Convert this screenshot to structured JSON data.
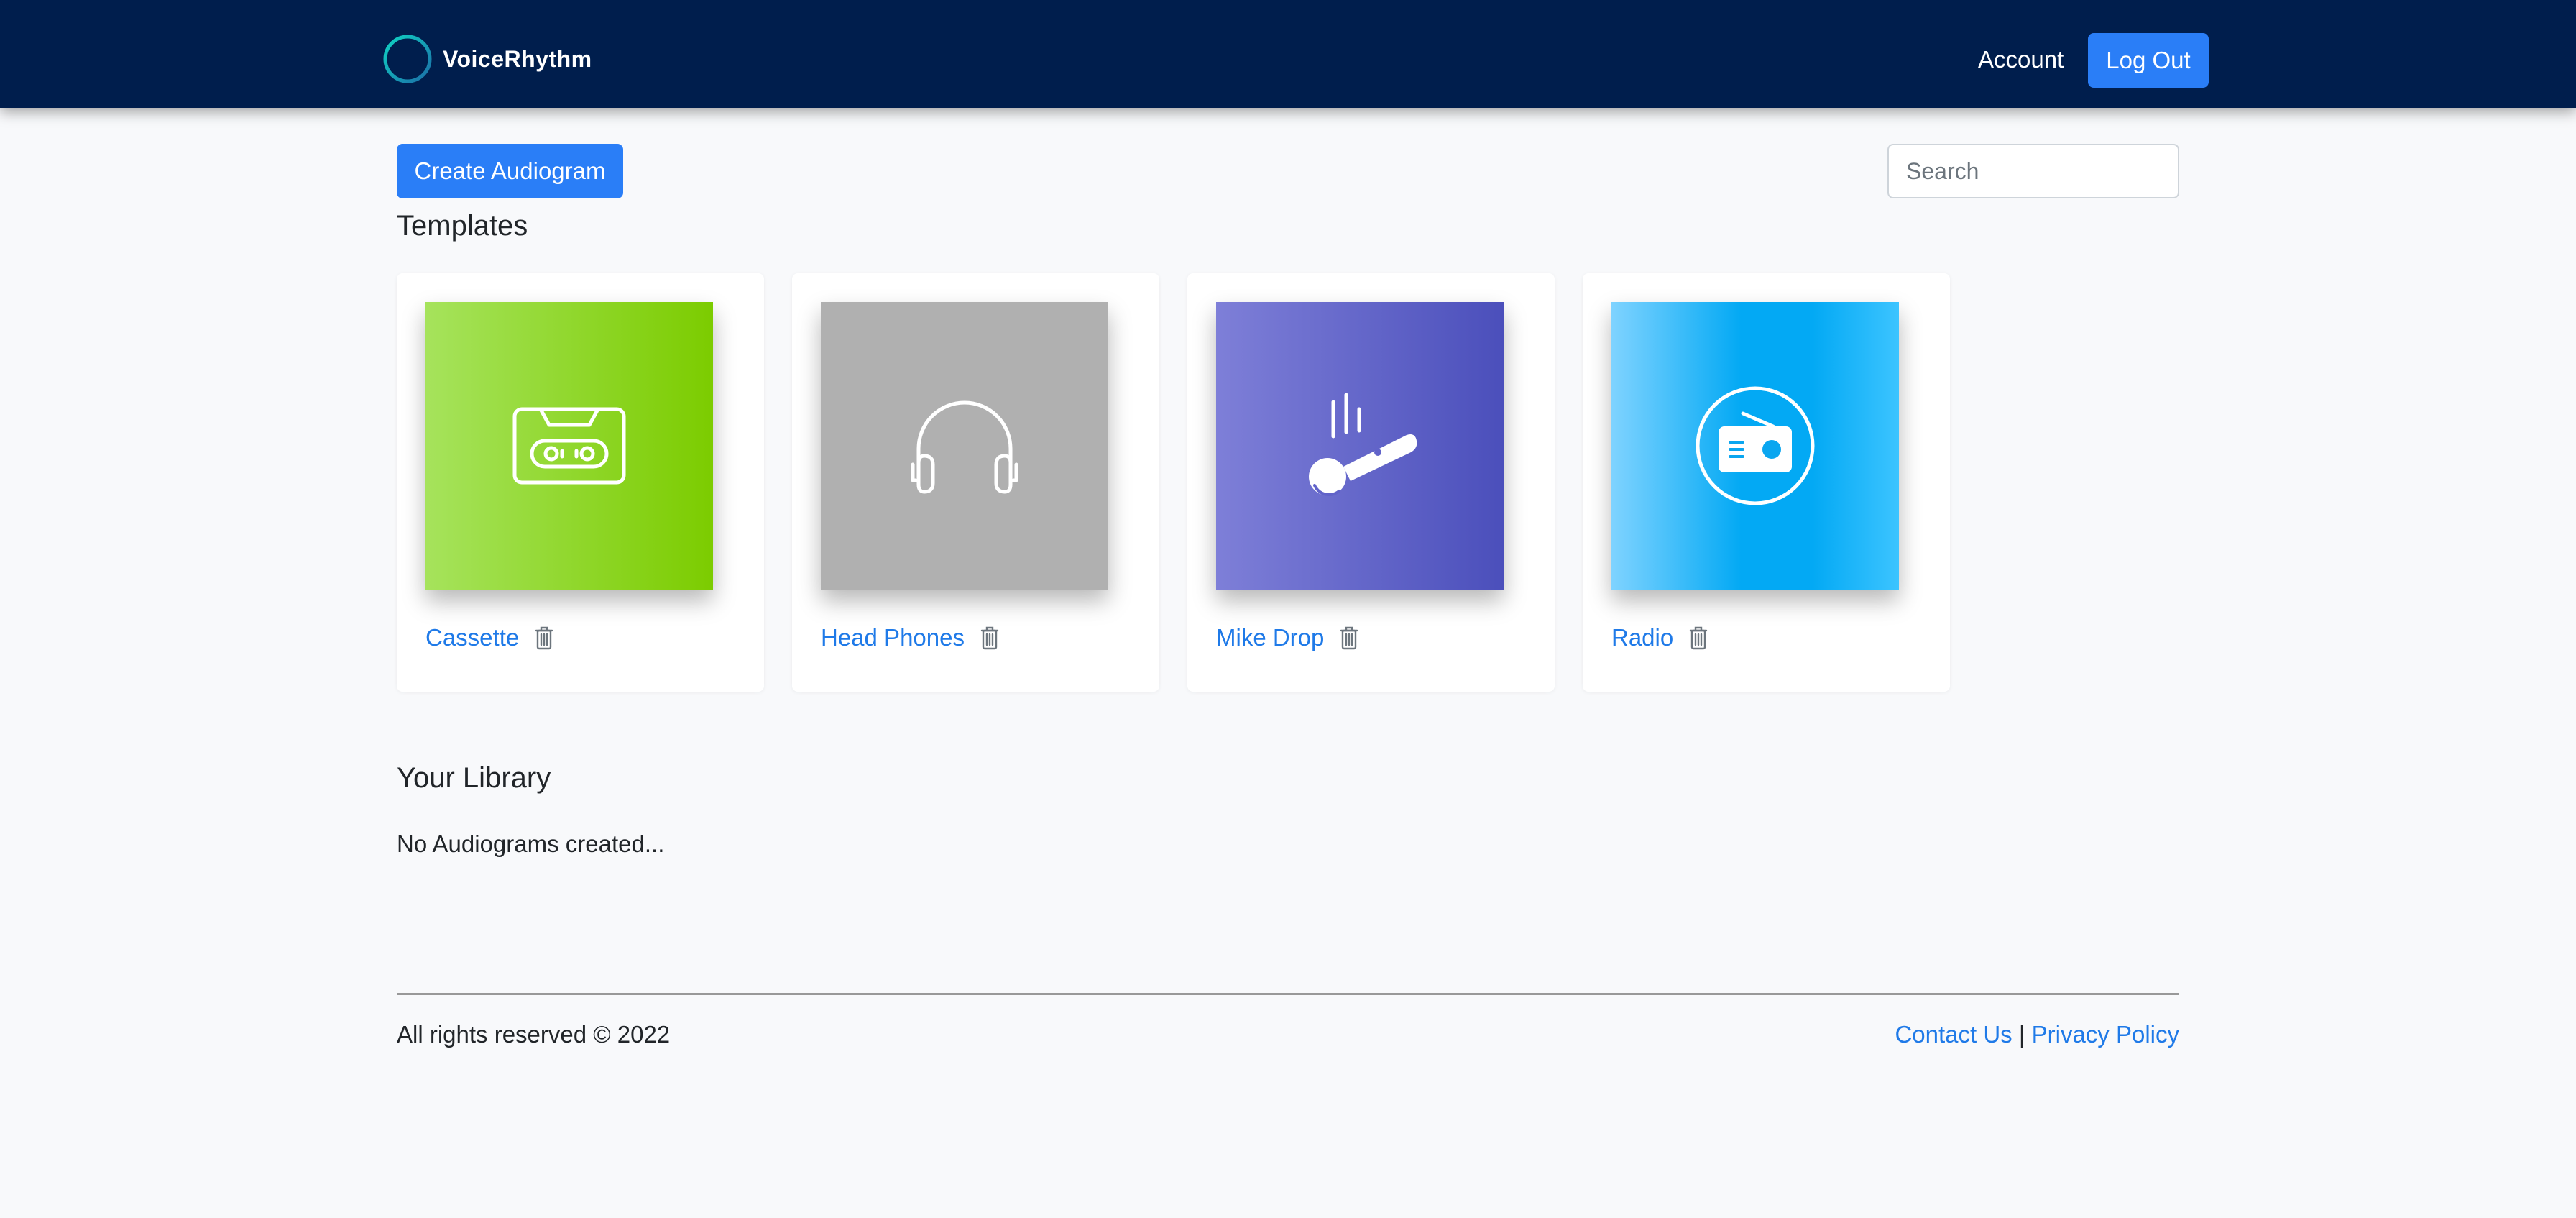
{
  "navbar": {
    "brand_name": "VoiceRhythm",
    "account_label": "Account",
    "logout_label": "Log Out"
  },
  "toolbar": {
    "create_label": "Create Audiogram",
    "search_placeholder": "Search"
  },
  "templates": {
    "title": "Templates",
    "items": [
      {
        "name": "Cassette",
        "icon": "cassette-icon",
        "gradient": [
          "#a6e35c",
          "#7ccc00"
        ]
      },
      {
        "name": "Head Phones",
        "icon": "headphones-icon",
        "gradient": [
          "#b0b0b0",
          "#b0b0b0"
        ]
      },
      {
        "name": "Mike Drop",
        "icon": "microphone-icon",
        "gradient": [
          "#7e7fd8",
          "#4b4fbb"
        ]
      },
      {
        "name": "Radio",
        "icon": "radio-icon",
        "gradient": [
          "#7fd3ff",
          "#03a9f4"
        ]
      }
    ]
  },
  "library": {
    "title": "Your Library",
    "empty_message": "No Audiograms created..."
  },
  "footer": {
    "copyright": "All rights reserved © 2022",
    "contact_label": "Contact Us",
    "separator": "|",
    "privacy_label": "Privacy Policy"
  },
  "colors": {
    "navbar_bg": "#001e4d",
    "primary": "#2a7ef7",
    "link": "#1f7ae8",
    "page_bg": "#f8f9fb"
  }
}
